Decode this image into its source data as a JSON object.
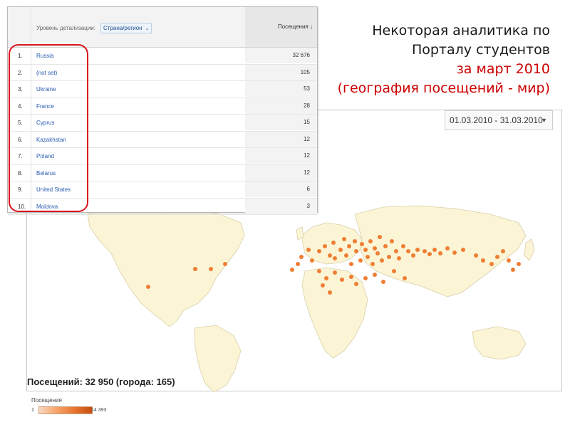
{
  "heading": {
    "line1": "Некоторая аналитика по",
    "line2": "Порталу студентов",
    "line3": "за март 2010",
    "line4": "(география посещений - мир)",
    "color_dark": "#1a1a1a",
    "color_red": "#cc0000"
  },
  "table": {
    "detail_label": "Уровень детализации:",
    "detail_value": "Страна/регион",
    "visits_header": "Посещения",
    "sort_icon": "arrow-down-icon",
    "rows": [
      {
        "num": "1.",
        "country": "Russia",
        "visits": "32 676"
      },
      {
        "num": "2.",
        "country": "(not set)",
        "visits": "105"
      },
      {
        "num": "3.",
        "country": "Ukraine",
        "visits": "53"
      },
      {
        "num": "4.",
        "country": "France",
        "visits": "28"
      },
      {
        "num": "5.",
        "country": "Cyprus",
        "visits": "15"
      },
      {
        "num": "6.",
        "country": "Kazakhstan",
        "visits": "12"
      },
      {
        "num": "7.",
        "country": "Poland",
        "visits": "12"
      },
      {
        "num": "8.",
        "country": "Belarus",
        "visits": "12"
      },
      {
        "num": "9.",
        "country": "United States",
        "visits": "6"
      },
      {
        "num": "10.",
        "country": "Moldova",
        "visits": "3"
      }
    ],
    "link_color": "#2a5db0",
    "highlight_color": "#d9141e"
  },
  "map": {
    "date_range": "01.03.2010 - 31.03.2010",
    "legend_title": "Посещения",
    "legend_min": "1",
    "legend_max": "14 393",
    "total_label": "Посещений: 32 950 (города: 165)",
    "land_color": "#fbf5d6",
    "water_color": "#ffffff",
    "dot_color": "#ef7e34"
  }
}
